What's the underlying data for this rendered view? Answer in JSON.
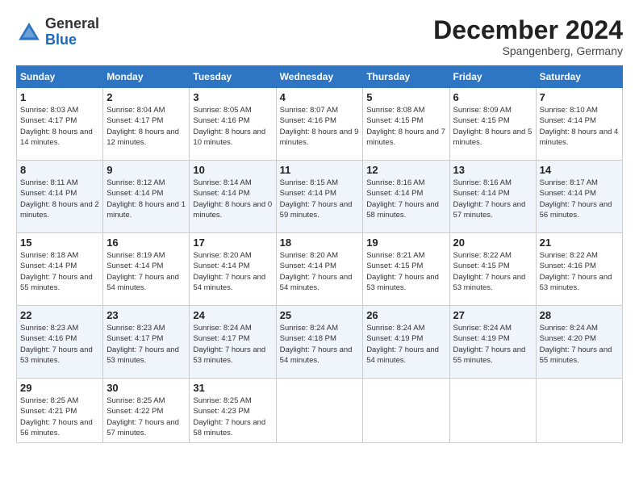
{
  "header": {
    "logo_line1": "General",
    "logo_line2": "Blue",
    "month": "December 2024",
    "location": "Spangenberg, Germany"
  },
  "days_of_week": [
    "Sunday",
    "Monday",
    "Tuesday",
    "Wednesday",
    "Thursday",
    "Friday",
    "Saturday"
  ],
  "weeks": [
    [
      {
        "day": 1,
        "sunrise": "8:03 AM",
        "sunset": "4:17 PM",
        "daylight": "8 hours and 14 minutes"
      },
      {
        "day": 2,
        "sunrise": "8:04 AM",
        "sunset": "4:17 PM",
        "daylight": "8 hours and 12 minutes"
      },
      {
        "day": 3,
        "sunrise": "8:05 AM",
        "sunset": "4:16 PM",
        "daylight": "8 hours and 10 minutes"
      },
      {
        "day": 4,
        "sunrise": "8:07 AM",
        "sunset": "4:16 PM",
        "daylight": "8 hours and 9 minutes"
      },
      {
        "day": 5,
        "sunrise": "8:08 AM",
        "sunset": "4:15 PM",
        "daylight": "8 hours and 7 minutes"
      },
      {
        "day": 6,
        "sunrise": "8:09 AM",
        "sunset": "4:15 PM",
        "daylight": "8 hours and 5 minutes"
      },
      {
        "day": 7,
        "sunrise": "8:10 AM",
        "sunset": "4:14 PM",
        "daylight": "8 hours and 4 minutes"
      }
    ],
    [
      {
        "day": 8,
        "sunrise": "8:11 AM",
        "sunset": "4:14 PM",
        "daylight": "8 hours and 2 minutes"
      },
      {
        "day": 9,
        "sunrise": "8:12 AM",
        "sunset": "4:14 PM",
        "daylight": "8 hours and 1 minute"
      },
      {
        "day": 10,
        "sunrise": "8:14 AM",
        "sunset": "4:14 PM",
        "daylight": "8 hours and 0 minutes"
      },
      {
        "day": 11,
        "sunrise": "8:15 AM",
        "sunset": "4:14 PM",
        "daylight": "7 hours and 59 minutes"
      },
      {
        "day": 12,
        "sunrise": "8:16 AM",
        "sunset": "4:14 PM",
        "daylight": "7 hours and 58 minutes"
      },
      {
        "day": 13,
        "sunrise": "8:16 AM",
        "sunset": "4:14 PM",
        "daylight": "7 hours and 57 minutes"
      },
      {
        "day": 14,
        "sunrise": "8:17 AM",
        "sunset": "4:14 PM",
        "daylight": "7 hours and 56 minutes"
      }
    ],
    [
      {
        "day": 15,
        "sunrise": "8:18 AM",
        "sunset": "4:14 PM",
        "daylight": "7 hours and 55 minutes"
      },
      {
        "day": 16,
        "sunrise": "8:19 AM",
        "sunset": "4:14 PM",
        "daylight": "7 hours and 54 minutes"
      },
      {
        "day": 17,
        "sunrise": "8:20 AM",
        "sunset": "4:14 PM",
        "daylight": "7 hours and 54 minutes"
      },
      {
        "day": 18,
        "sunrise": "8:20 AM",
        "sunset": "4:14 PM",
        "daylight": "7 hours and 54 minutes"
      },
      {
        "day": 19,
        "sunrise": "8:21 AM",
        "sunset": "4:15 PM",
        "daylight": "7 hours and 53 minutes"
      },
      {
        "day": 20,
        "sunrise": "8:22 AM",
        "sunset": "4:15 PM",
        "daylight": "7 hours and 53 minutes"
      },
      {
        "day": 21,
        "sunrise": "8:22 AM",
        "sunset": "4:16 PM",
        "daylight": "7 hours and 53 minutes"
      }
    ],
    [
      {
        "day": 22,
        "sunrise": "8:23 AM",
        "sunset": "4:16 PM",
        "daylight": "7 hours and 53 minutes"
      },
      {
        "day": 23,
        "sunrise": "8:23 AM",
        "sunset": "4:17 PM",
        "daylight": "7 hours and 53 minutes"
      },
      {
        "day": 24,
        "sunrise": "8:24 AM",
        "sunset": "4:17 PM",
        "daylight": "7 hours and 53 minutes"
      },
      {
        "day": 25,
        "sunrise": "8:24 AM",
        "sunset": "4:18 PM",
        "daylight": "7 hours and 54 minutes"
      },
      {
        "day": 26,
        "sunrise": "8:24 AM",
        "sunset": "4:19 PM",
        "daylight": "7 hours and 54 minutes"
      },
      {
        "day": 27,
        "sunrise": "8:24 AM",
        "sunset": "4:19 PM",
        "daylight": "7 hours and 55 minutes"
      },
      {
        "day": 28,
        "sunrise": "8:24 AM",
        "sunset": "4:20 PM",
        "daylight": "7 hours and 55 minutes"
      }
    ],
    [
      {
        "day": 29,
        "sunrise": "8:25 AM",
        "sunset": "4:21 PM",
        "daylight": "7 hours and 56 minutes"
      },
      {
        "day": 30,
        "sunrise": "8:25 AM",
        "sunset": "4:22 PM",
        "daylight": "7 hours and 57 minutes"
      },
      {
        "day": 31,
        "sunrise": "8:25 AM",
        "sunset": "4:23 PM",
        "daylight": "7 hours and 58 minutes"
      },
      null,
      null,
      null,
      null
    ]
  ]
}
